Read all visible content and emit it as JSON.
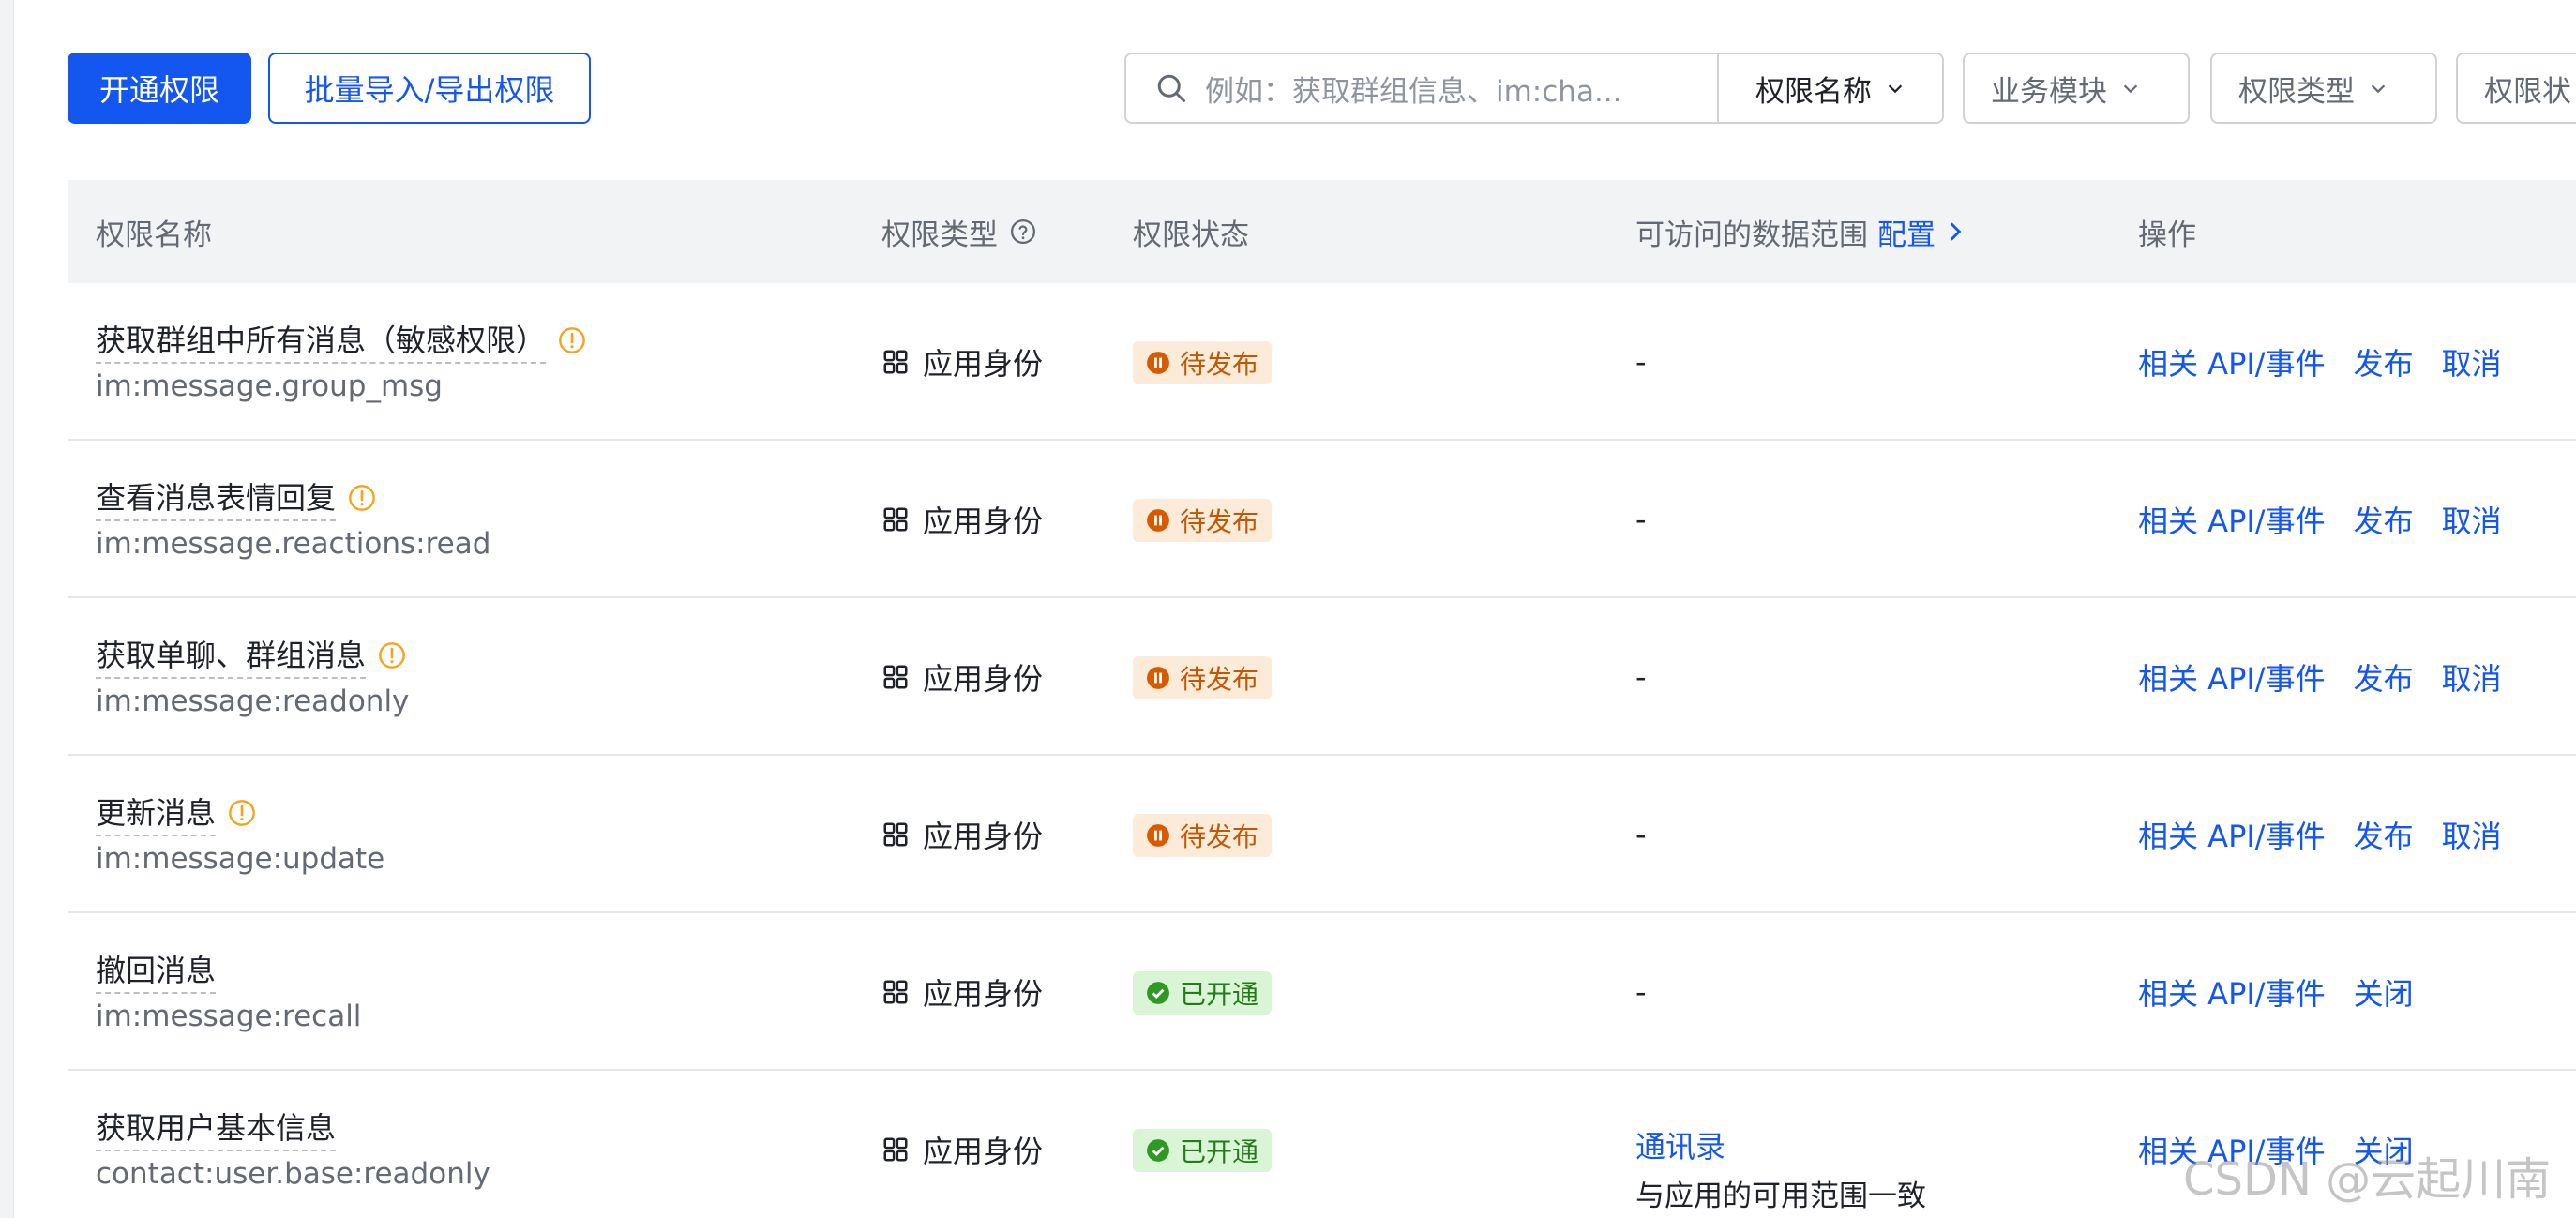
{
  "toolbar": {
    "primary_label": "开通权限",
    "secondary_label": "批量导入/导出权限"
  },
  "search": {
    "placeholder": "例如：获取群组信息、im:cha...",
    "field_select": "权限名称"
  },
  "filters": [
    "业务模块",
    "权限类型",
    "权限状"
  ],
  "table": {
    "headers": {
      "name": "权限名称",
      "type": "权限类型",
      "status": "权限状态",
      "scope": "可访问的数据范围",
      "scope_link": "配置",
      "actions": "操作"
    },
    "rows": [
      {
        "name": "获取群组中所有消息（敏感权限）",
        "code": "im:message.group_msg",
        "warn": true,
        "type": "应用身份",
        "status": "待发布",
        "status_kind": "pending",
        "scope": "-",
        "actions": [
          "相关 API/事件",
          "发布",
          "取消"
        ]
      },
      {
        "name": "查看消息表情回复",
        "code": "im:message.reactions:read",
        "warn": true,
        "type": "应用身份",
        "status": "待发布",
        "status_kind": "pending",
        "scope": "-",
        "actions": [
          "相关 API/事件",
          "发布",
          "取消"
        ]
      },
      {
        "name": "获取单聊、群组消息",
        "code": "im:message:readonly",
        "warn": true,
        "type": "应用身份",
        "status": "待发布",
        "status_kind": "pending",
        "scope": "-",
        "actions": [
          "相关 API/事件",
          "发布",
          "取消"
        ]
      },
      {
        "name": "更新消息",
        "code": "im:message:update",
        "warn": true,
        "type": "应用身份",
        "status": "待发布",
        "status_kind": "pending",
        "scope": "-",
        "actions": [
          "相关 API/事件",
          "发布",
          "取消"
        ]
      },
      {
        "name": "撤回消息",
        "code": "im:message:recall",
        "warn": false,
        "type": "应用身份",
        "status": "已开通",
        "status_kind": "open",
        "scope": "-",
        "actions": [
          "相关 API/事件",
          "关闭"
        ]
      },
      {
        "name": "获取用户基本信息",
        "code": "contact:user.base:readonly",
        "warn": false,
        "type": "应用身份",
        "status": "已开通",
        "status_kind": "open",
        "scope_link": "通讯录",
        "scope_sub": "与应用的可用范围一致",
        "actions": [
          "相关 API/事件",
          "关闭"
        ]
      }
    ]
  },
  "watermark": "CSDN @云起川南",
  "colors": {
    "accent": "#1456f0",
    "pending": "#c25705",
    "open": "#237b19",
    "warn": "#f7a21b"
  }
}
